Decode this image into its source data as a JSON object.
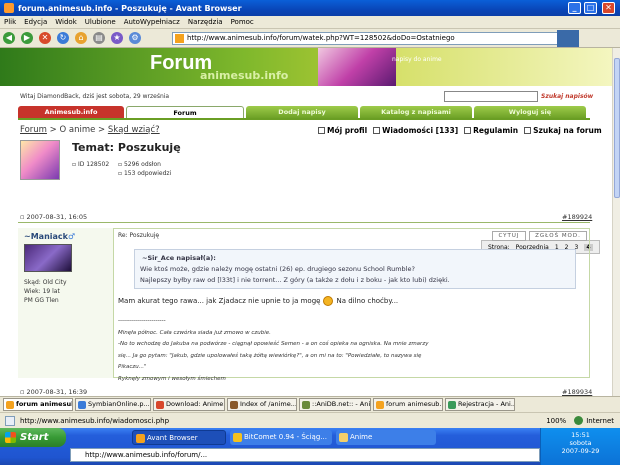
{
  "window": {
    "title": "forum.animesub.info - Poszukuję - Avant Browser",
    "min": "_",
    "max": "□",
    "close": "✕"
  },
  "menu": [
    "Plik",
    "Edycja",
    "Widok",
    "Ulubione",
    "AutoWypełniacz",
    "Narzędzia",
    "Pomoc"
  ],
  "toolbar": {
    "address": "http://www.animesub.info/forum/watek.php?WT=128502&doDo=Ostatniego"
  },
  "banner": {
    "title": "Forum",
    "subtitle": "animesub.info",
    "note": "napisy do anime"
  },
  "header": {
    "welcome": "Witaj DiamondBack, dziś jest sobota, 29 września",
    "search_link": "Szukaj napisów"
  },
  "tabs": [
    "Animesub.info",
    "Forum",
    "Dodaj napisy",
    "Katalog z napisami",
    "Wyloguj się"
  ],
  "breadcrumb": {
    "root": "Forum",
    "sep1": " > ",
    "section": "O anime",
    "sep2": " > ",
    "current": "Skąd wziąć?"
  },
  "actions": [
    "Mój profil",
    "Wiadomości [133]",
    "Regulamin",
    "Szukaj na forum"
  ],
  "topic": {
    "prefix": "Temat:",
    "title": "Poszukuję",
    "id": "ID 128502",
    "views": "5296 odsłon",
    "replies": "153 odpowiedzi"
  },
  "pager": {
    "label": "Strona:",
    "prev": "Poprzednia",
    "pages": [
      "1",
      "2",
      "3",
      "4"
    ],
    "current": "4"
  },
  "post": {
    "date": "2007-08-31, 16:05",
    "number": "#189924",
    "author": "~Maniack",
    "gender": "♂",
    "stats": [
      "Skąd: Old City",
      "Wiek: 19 lat",
      "PM GG Tlen"
    ],
    "subject": "Re: Poszukuję",
    "quote_btn": "CYTUJ",
    "report_btn": "ZGŁOŚ MOD.",
    "quote_head": "~Sir_Ace napisał(a):",
    "quote_lines": [
      "Wie ktoś może, gdzie należy mogę ostatni (26) ep. drugiego sezonu School Rumble?",
      "Najlepszy byłby raw od [l33t] i nie torrent... Z góry (a także z dołu i z boku - jak kto lubi) dzięki."
    ],
    "body": "Mam akurat tego rawa... jak Zjadacz nie upnie to ja mogę",
    "body_end": "Na dilno choćby...",
    "sig_sep": "------------------------",
    "sig_lines": [
      "Minęła północ. Cała czwórka siada już zmowo w czubie.",
      "-No to wchodzę do Jakuba na podwórze - ciągnął opowieść Semen - a on coś opieka na ogniska. Na mnie zmarzy",
      "się... Ja go pytam: \"Jakub, gdzie upolowałeś taką żółtą wiewiórkę?\", a on mi na to: \"Powiedziałe, to nazywa się",
      "Pikaczu...\"",
      "Ryknęły zmowym i wesołym śmiechem"
    ]
  },
  "post2": {
    "date": "2007-08-31, 16:39",
    "number": "#189934"
  },
  "browser_tabs": [
    "forum animesub...",
    "SymbianOnline.p...",
    "Download: Anime...",
    "Index of /anime...",
    "::AniDB.net:: - Ani...",
    "forum animesub...",
    "Rejestracja - Ani..."
  ],
  "status": {
    "url": "http://www.animesub.info/wiadomosci.php",
    "zone": "Internet",
    "zoom": "100%"
  },
  "taskbar": {
    "start": "Start",
    "tasks": [
      "Avant Browser",
      "BitComet 0.94 - Ściąg...",
      "Anime"
    ],
    "address": "http://www.animesub.info/forum/...",
    "time": "15:51",
    "day": "sobota",
    "date": "2007-09-29"
  }
}
